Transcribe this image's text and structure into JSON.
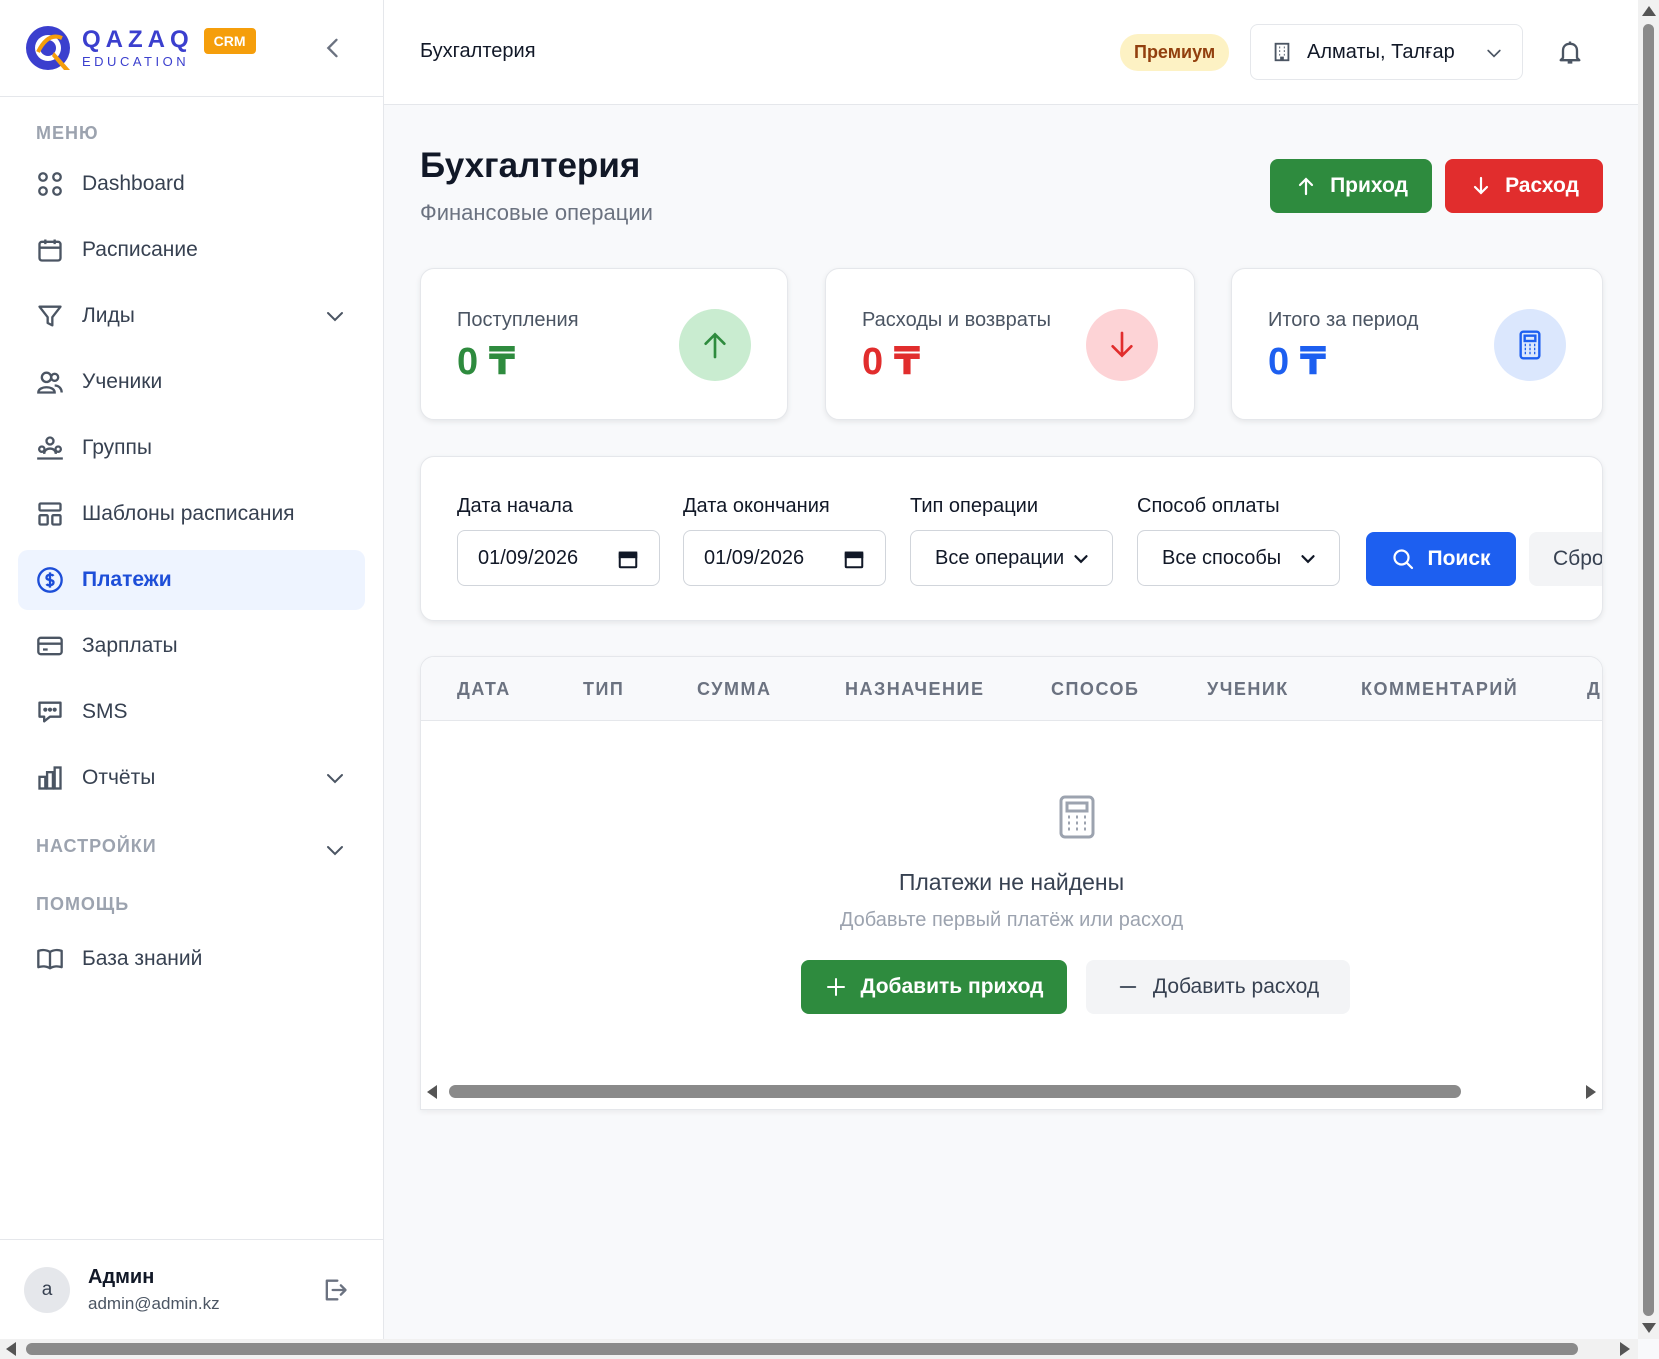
{
  "brand": {
    "name": "QAZAQ",
    "sub": "EDUCATION",
    "badge": "CRM",
    "primary_color": "#3b3fce",
    "accent_color": "#f59e0b"
  },
  "sidebar": {
    "menu_label": "МЕНЮ",
    "items": [
      {
        "label": "Dashboard",
        "icon": "grid-icon"
      },
      {
        "label": "Расписание",
        "icon": "calendar-icon"
      },
      {
        "label": "Лиды",
        "icon": "filter-icon",
        "expandable": true
      },
      {
        "label": "Ученики",
        "icon": "users-icon"
      },
      {
        "label": "Группы",
        "icon": "group-icon"
      },
      {
        "label": "Шаблоны расписания",
        "icon": "layout-icon"
      },
      {
        "label": "Платежи",
        "icon": "dollar-icon",
        "active": true
      },
      {
        "label": "Зарплаты",
        "icon": "wallet-icon"
      },
      {
        "label": "SMS",
        "icon": "message-icon"
      },
      {
        "label": "Отчёты",
        "icon": "bar-chart-icon",
        "expandable": true
      }
    ],
    "settings_label": "НАСТРОЙКИ",
    "help_label": "ПОМОЩЬ",
    "help_items": [
      {
        "label": "База знаний",
        "icon": "book-icon"
      }
    ]
  },
  "user": {
    "avatar_letter": "a",
    "name": "Админ",
    "email": "admin@admin.kz"
  },
  "topbar": {
    "title": "Бухгалтерия",
    "plan_badge": "Премиум",
    "branch": "Алматы, Талғар"
  },
  "page": {
    "title": "Бухгалтерия",
    "subtitle": "Финансовые операции",
    "income_button": "Приход",
    "expense_button": "Расход"
  },
  "stats": [
    {
      "label": "Поступления",
      "value": "0 ₸",
      "color": "#2e8b3e",
      "icon": "arrow-up-icon",
      "icon_bg": "#c9ecd0"
    },
    {
      "label": "Расходы и возвраты",
      "value": "0 ₸",
      "color": "#e12d2d",
      "icon": "arrow-down-icon",
      "icon_bg": "#fdd3d6"
    },
    {
      "label": "Итого за период",
      "value": "0 ₸",
      "color": "#1d5ff0",
      "icon": "calculator-icon",
      "icon_bg": "#dbe7fd"
    }
  ],
  "filters": {
    "start_date_label": "Дата начала",
    "start_date_value": "01/09/2026",
    "end_date_label": "Дата окончания",
    "end_date_value": "01/09/2026",
    "type_label": "Тип операции",
    "type_value": "Все операции",
    "method_label": "Способ оплаты",
    "method_value": "Все способы",
    "search_button": "Поиск",
    "reset_button": "Сбросить"
  },
  "table": {
    "columns": [
      "ДАТА",
      "ТИП",
      "СУММА",
      "НАЗНАЧЕНИЕ",
      "СПОСОБ",
      "УЧЕНИК",
      "КОММЕНТАРИЙ",
      "Д"
    ],
    "empty_title": "Платежи не найдены",
    "empty_subtitle": "Добавьте первый платёж или расход",
    "add_income_button": "Добавить приход",
    "add_expense_button": "Добавить расход"
  }
}
